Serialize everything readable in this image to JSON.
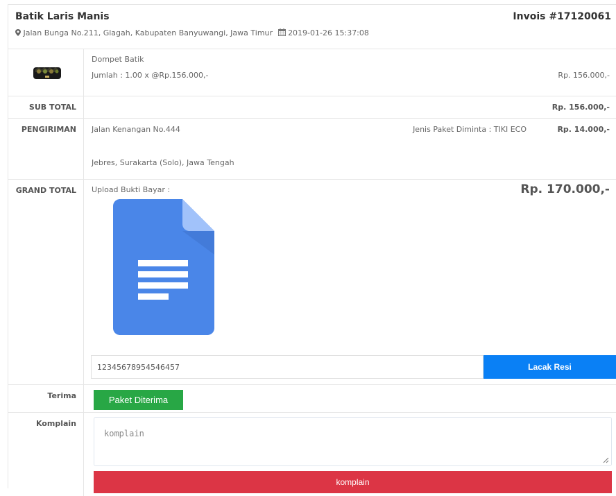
{
  "invoice": {
    "store_name": "Batik Laris Manis",
    "invoice_number": "Invois #17120061",
    "store_address": "Jalan Bunga No.211, Glagah, Kabupaten Banyuwangi, Jawa Timur",
    "order_datetime": "2019-01-26 15:37:08"
  },
  "product": {
    "name": "Dompet Batik",
    "quantity_line": "Jumlah : 1.00 x @Rp.156.000,-",
    "price": "Rp. 156.000,-"
  },
  "subtotal": {
    "label": "SUB TOTAL",
    "value": "Rp. 156.000,-"
  },
  "shipping": {
    "label": "PENGIRIMAN",
    "address_line1": "Jalan Kenangan No.444",
    "address_line2": "Jebres, Surakarta (Solo), Jawa Tengah",
    "package_type": "Jenis Paket Diminta : TIKI ECO",
    "cost": "Rp. 14.000,-"
  },
  "grand_total": {
    "label": "GRAND TOTAL",
    "upload_label": "Upload Bukti Bayar :",
    "value": "Rp. 170.000,-",
    "tracking_number": "12345678954546457",
    "track_button": "Lacak Resi"
  },
  "receive": {
    "label": "Terima",
    "button": "Paket Diterima"
  },
  "complaint": {
    "label": "Komplain",
    "placeholder": "komplain",
    "button": "komplain"
  },
  "colors": {
    "track_button": "#0a80f5",
    "accept_button": "#28a745",
    "complaint_button": "#dc3545",
    "doc_icon": "#4285f4"
  },
  "icons": {
    "address": "map-marker-icon",
    "date": "calendar-icon",
    "proof": "document-icon"
  }
}
